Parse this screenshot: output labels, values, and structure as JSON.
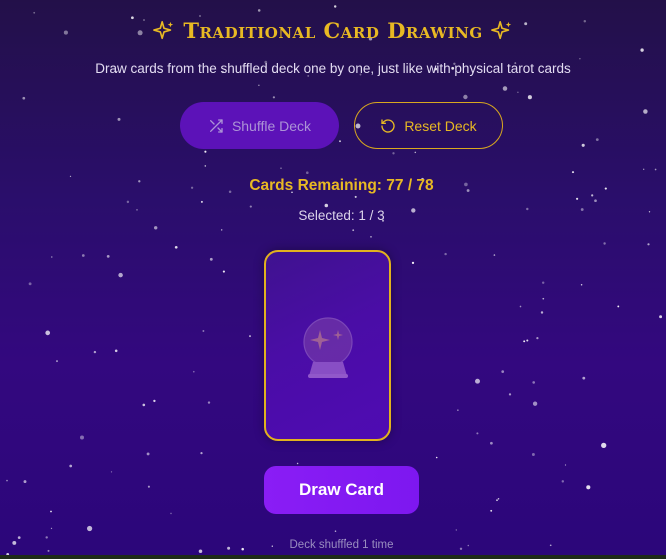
{
  "header": {
    "title": "Traditional Card Drawing",
    "subtitle": "Draw cards from the shuffled deck one by one, just like with physical tarot cards"
  },
  "controls": {
    "shuffle_label": "Shuffle Deck",
    "shuffle_icon": "shuffle-icon",
    "reset_label": "Reset Deck",
    "reset_icon": "rotate-ccw-icon"
  },
  "status": {
    "remaining": "Cards Remaining: 77 / 78",
    "selected": "Selected: 1 / 3"
  },
  "card": {
    "icon": "crystal-ball-icon"
  },
  "draw_label": "Draw Card",
  "footer_note": "Deck shuffled 1 time",
  "colors": {
    "accent_gold": "#e8b923",
    "primary_purple": "#8a1df5",
    "background": "#2b067a"
  }
}
